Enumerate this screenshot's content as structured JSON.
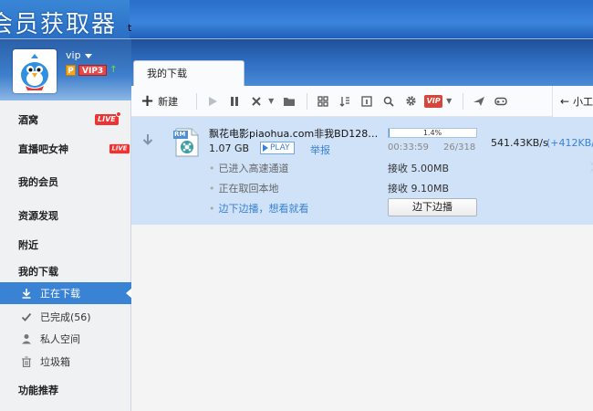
{
  "background_window": {
    "title": "会员获取器",
    "mark": "t"
  },
  "user": {
    "name": "vip",
    "vip_level_prefix": "P",
    "vip_level": "VIP3",
    "upgrade_icon": "up-arrow-icon"
  },
  "sidebar": {
    "items": [
      {
        "label": "酒窝",
        "badge": "LIVE"
      },
      {
        "label": "直播吧女神",
        "badge": "LIVE"
      },
      {
        "label": "我的会员"
      },
      {
        "label": "资源发现"
      },
      {
        "label": "附近"
      },
      {
        "label": "我的下载"
      }
    ],
    "sub_items": [
      {
        "label": "正在下载",
        "icon": "download-arrow-icon",
        "active": true
      },
      {
        "label": "已完成(56)",
        "icon": "checkmark-icon"
      },
      {
        "label": "私人空间",
        "icon": "user-icon"
      },
      {
        "label": "垃圾箱",
        "icon": "trash-icon"
      }
    ],
    "section": "功能推荐"
  },
  "tab": {
    "label": "我的下载"
  },
  "toolbar": {
    "new_label": "新建",
    "icons": [
      "play-icon",
      "pause-icon",
      "delete-icon",
      "folder-icon",
      "grid-icon",
      "sort-icon",
      "info-icon",
      "search-icon",
      "gear-icon",
      "vip-icon",
      "plane-icon",
      "gamepad-icon"
    ],
    "vip_text": "VIP",
    "tools_label": "小工"
  },
  "download": {
    "file_type": "RM",
    "name": "飘花电影piaohua.com非我BD1280高...",
    "size": "1.07 GB",
    "play_label": "PLAY",
    "report_label": "举报",
    "details": [
      "已进入高速通道",
      "正在取回本地"
    ],
    "stream_link": "边下边播，想看就看",
    "progress_text": "1.4%",
    "progress_fraction": 0.014,
    "elapsed": "00:33:59",
    "pieces": "26/318",
    "received_1": "接收 5.00MB",
    "received_2": "接收 9.10MB",
    "stream_button": "边下边播",
    "speed": "541.43KB/s",
    "speed_extra": "(+412KB/s"
  },
  "colors": {
    "accent": "#3a82d4",
    "header": "#2f6ec2",
    "row_selected": "#cfe2f8",
    "live_red": "#e33333"
  }
}
